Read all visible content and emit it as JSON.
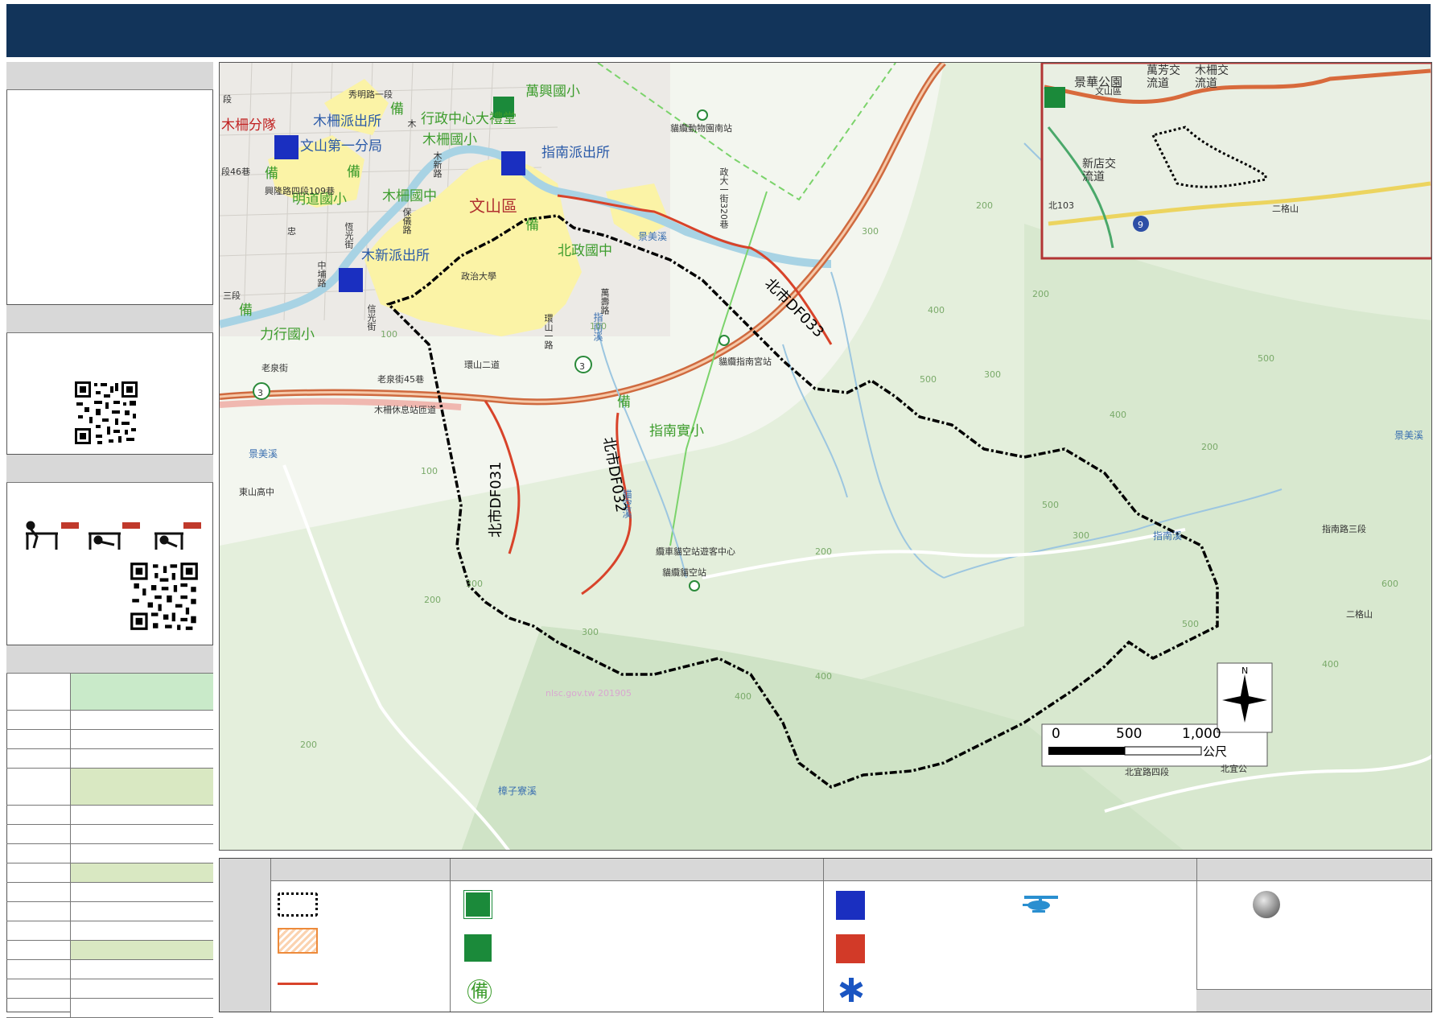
{
  "map": {
    "district_label": "文山區",
    "schools": [
      "萬興國小",
      "行政中心大禮堂",
      "木柵國小",
      "明道國小",
      "木柵國中",
      "北政國中",
      "力行國小",
      "指南實小",
      "東山高中"
    ],
    "police": [
      "木柵分隊",
      "木柵派出所",
      "文山第一分局",
      "指南派出所",
      "木新派出所"
    ],
    "streets": [
      "秀明路一段",
      "興隆路四段109巷",
      "木新路",
      "中埔路",
      "忠",
      "保儀路",
      "政大一街320巷",
      "萬壽路",
      "老泉街",
      "老泉街45巷",
      "木柵休息站匝道",
      "環山二道",
      "環山一路",
      "指南路三段",
      "北宜路四段",
      "北宜公",
      "段",
      "三段",
      "段46巷",
      "信光街",
      "木",
      "恆光街"
    ],
    "rivers": [
      "景美溪",
      "指南溪",
      "指南溪",
      "樟子寮溪",
      "貓空溪",
      "景美溪",
      "景美溪"
    ],
    "stations": [
      "貓纜動物園南站",
      "貓纜指南宮站",
      "纜車貓空站遊客中心",
      "貓纜貓空站"
    ],
    "peaks": [
      "二格山"
    ],
    "university": "政治大學",
    "debris_flow": [
      "北市DF031",
      "北市DF032",
      "北市DF033"
    ],
    "backup": "備",
    "watermark": "nlsc.gov.tw 201905",
    "contours": [
      "100",
      "100",
      "200",
      "300",
      "400",
      "500",
      "400",
      "300",
      "200",
      "500",
      "600",
      "500",
      "400",
      "300",
      "200",
      "100",
      "200",
      "300",
      "400",
      "500",
      "300",
      "200",
      "400",
      "200"
    ],
    "highway_3": "3",
    "scale": {
      "ticks": [
        "0",
        "500",
        "1,000"
      ],
      "unit": "公尺"
    },
    "north": "N"
  },
  "inset": {
    "labels": [
      "景華公園",
      "萬芳交流道",
      "木柵交流道",
      "新店交流道",
      "文山區",
      "北103",
      "二格山",
      "9"
    ]
  },
  "colors": {
    "header": "#12345a",
    "boundary": "#000000",
    "debris_line": "#d8432a",
    "district_fill": "#fbf3a6",
    "highway": "#cf6a3f",
    "cable": "#7bd36b",
    "table_green": "#c9eac9",
    "table_olive": "#d9e8c2"
  }
}
